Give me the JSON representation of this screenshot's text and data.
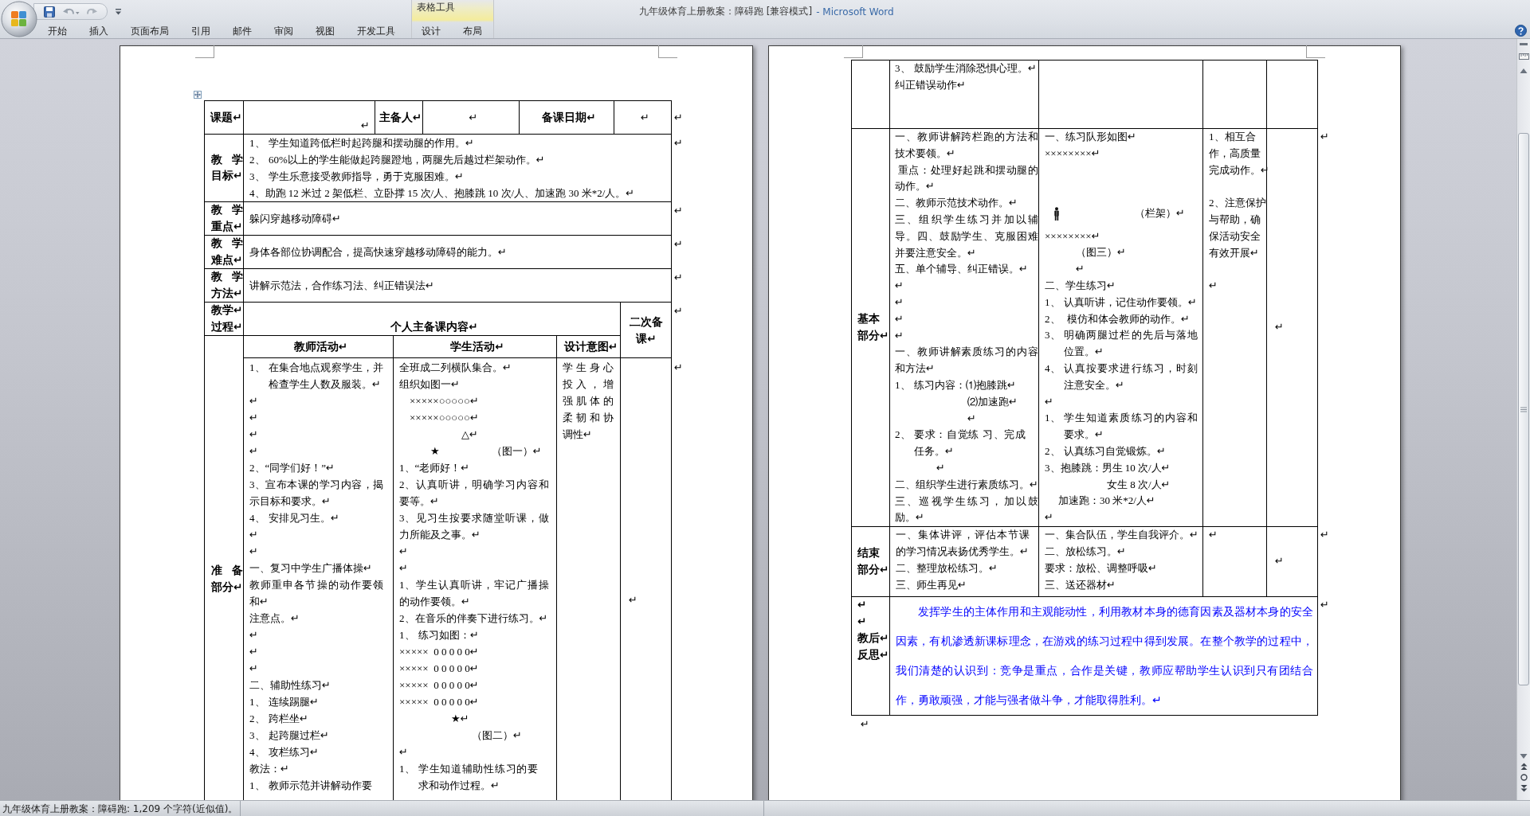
{
  "window": {
    "document_title": "九年级体育上册教案：障碍跑 [兼容模式]",
    "app_title": "- Microsoft Word"
  },
  "ribbon": {
    "tabs": [
      {
        "label": "开始",
        "selected": false
      },
      {
        "label": "插入",
        "selected": false
      },
      {
        "label": "页面布局",
        "selected": false
      },
      {
        "label": "引用",
        "selected": false
      },
      {
        "label": "邮件",
        "selected": false
      },
      {
        "label": "审阅",
        "selected": false
      },
      {
        "label": "视图",
        "selected": false
      },
      {
        "label": "开发工具",
        "selected": false
      }
    ],
    "contextual_group": {
      "title": "表格工具",
      "tabs": [
        {
          "label": "设计",
          "selected": false
        },
        {
          "label": "布局",
          "selected": false
        }
      ]
    }
  },
  "left_page": {
    "info_row": {
      "topic_label": "课题↵",
      "topic_value": "↵",
      "preparer_label": "主备人↵",
      "preparer_value": "↵",
      "date_label": "备课日期↵",
      "date_value": "↵",
      "end_mark": "↵"
    },
    "sections": [
      {
        "label": "教学目标↵",
        "paragraphs": [
          {
            "kind": "numbered",
            "number": "1、",
            "text": "学生知道跨低栏时起跨腿和摆动腿的作用。↵"
          },
          {
            "kind": "numbered",
            "number": "2、",
            "text": "60%以上的学生能做起跨腿蹬地，两腿先后越过栏架动作。↵"
          },
          {
            "kind": "numbered",
            "number": "3、",
            "text": "学生乐意接受教师指导，勇于克服困难。↵"
          },
          {
            "kind": "plain",
            "text": "4、助跑 12 米过 2 架低栏、立卧撑 15 次/人、抱膝跳 10 次/人、加速跑 30 米*2/人。↵"
          }
        ],
        "end_mark": "↵"
      },
      {
        "label": "教学重点↵",
        "paragraphs": [
          "躲闪穿越移动障碍↵"
        ],
        "end_mark": "↵"
      },
      {
        "label": "教学难点↵",
        "paragraphs": [
          "身体各部位协调配合，提高快速穿越移动障碍的能力。↵"
        ],
        "end_mark": "↵"
      },
      {
        "label": "教学方法↵",
        "paragraphs": [
          "讲解示范法，合作练习法、纠正错误法↵"
        ],
        "end_mark": "↵"
      }
    ],
    "process_row": {
      "label": [
        "教学↵",
        "过程↵"
      ],
      "title": "个人主备课内容↵",
      "second_title": "二次备课↵",
      "end_mark": "↵"
    },
    "column_headers": [
      "教师活动↵",
      "学生活动↵",
      "设计意图↵"
    ],
    "prep_row": {
      "label": "准备部分↵",
      "teacher": [
        {
          "kind": "numbered",
          "number": "1、",
          "text": "在集合地点观察学生，并检查学生人数及服装。↵"
        },
        {
          "kind": "plain",
          "text": "↵"
        },
        {
          "kind": "plain",
          "text": "↵"
        },
        {
          "kind": "plain",
          "text": "↵"
        },
        {
          "kind": "plain",
          "text": "↵"
        },
        {
          "kind": "plain",
          "text": "2、“同学们好！”↵"
        },
        {
          "kind": "plain",
          "text": "3、宣布本课的学习内容，揭示目标和要求。↵"
        },
        {
          "kind": "numbered",
          "number": "4、",
          "text": "安排见习生。↵"
        },
        {
          "kind": "plain",
          "text": "↵"
        },
        {
          "kind": "plain",
          "text": "↵"
        },
        {
          "kind": "plain",
          "text": "一、复习中学生广播体操↵"
        },
        {
          "kind": "plain",
          "text": "教师重申各节操的动作要领和↵"
        },
        {
          "kind": "plain",
          "text": "注意点。↵"
        },
        {
          "kind": "plain",
          "text": "↵"
        },
        {
          "kind": "plain",
          "text": "↵"
        },
        {
          "kind": "plain",
          "text": "↵"
        },
        {
          "kind": "plain",
          "text": "二、辅助性练习↵"
        },
        {
          "kind": "numbered",
          "number": "1、",
          "text": "连续踢腿↵"
        },
        {
          "kind": "numbered",
          "number": "2、",
          "text": "跨栏坐↵"
        },
        {
          "kind": "numbered",
          "number": "3、",
          "text": "起跨腿过栏↵"
        },
        {
          "kind": "numbered",
          "number": "4、",
          "text": "攻栏练习↵"
        },
        {
          "kind": "plain",
          "text": "教法：↵"
        },
        {
          "kind": "numbered",
          "number": "1、",
          "text": "教师示范并讲解动作要"
        }
      ],
      "student": [
        {
          "kind": "plain",
          "text": "全班成二列横队集合。↵"
        },
        {
          "kind": "plain",
          "text": "组织如图一↵"
        },
        {
          "kind": "plain",
          "text": "　×××××○○○○○↵"
        },
        {
          "kind": "plain",
          "text": "　×××××○○○○○↵"
        },
        {
          "kind": "plain",
          "text": "　　　　　　△↵"
        },
        {
          "kind": "plain",
          "text": "　　　★　　　　　（图一）↵"
        },
        {
          "kind": "plain",
          "text": "1、“老师好！↵"
        },
        {
          "kind": "plain",
          "text": "2、认真听讲，明确学习内容和要等。↵"
        },
        {
          "kind": "plain",
          "text": "3、见习生按要求随堂听课，做力所能及之事。↵"
        },
        {
          "kind": "plain",
          "text": "↵"
        },
        {
          "kind": "plain",
          "text": "↵"
        },
        {
          "kind": "plain",
          "text": "1、学生认真听讲，牢记广播操的动作要领。↵"
        },
        {
          "kind": "plain",
          "text": "2、在音乐的伴奏下进行练习。↵"
        },
        {
          "kind": "numbered",
          "number": "1、",
          "text": "练习如图：↵"
        },
        {
          "kind": "plain",
          "text": "×××××  0 0 0 0 0↵"
        },
        {
          "kind": "plain",
          "text": "×××××  0 0 0 0 0↵"
        },
        {
          "kind": "plain",
          "text": "×××××  0 0 0 0 0↵"
        },
        {
          "kind": "plain",
          "text": "×××××  0 0 0 0 0↵"
        },
        {
          "kind": "plain",
          "text": "　　　　　★↵"
        },
        {
          "kind": "plain",
          "text": "　　　　　　　（图二）↵"
        },
        {
          "kind": "plain",
          "text": "↵"
        },
        {
          "kind": "numbered",
          "number": "1、",
          "text": "学生知道辅助性练习的要求和动作过程。↵"
        }
      ],
      "design": "学生身心投入，增强肌体的柔韧和协调性↵",
      "second": "↵",
      "end_mark": "↵"
    }
  },
  "right_page": {
    "continued_row": {
      "teacher": [
        {
          "kind": "numbered",
          "number": "3、",
          "text": "鼓励学生消除恐惧心理。↵"
        },
        {
          "kind": "plain",
          "text": "纠正错误动作↵"
        }
      ]
    },
    "basic_row": {
      "label": "基本部分↵",
      "teacher": [
        {
          "kind": "plain",
          "text": "一、教师讲解跨栏跑的方法和技术要领。↵"
        },
        {
          "kind": "plain",
          "text": " 重点：处理好起跳和摆动腿的动作。↵"
        },
        {
          "kind": "plain",
          "text": "二、教师示范技术动作。↵"
        },
        {
          "kind": "plain",
          "text": "三、组织学生练习并加以辅导。四、鼓励学生、克服困难并要注意安全。↵"
        },
        {
          "kind": "plain",
          "text": "五、单个辅导、纠正错误。↵"
        },
        {
          "kind": "plain",
          "text": "↵"
        },
        {
          "kind": "plain",
          "text": "↵"
        },
        {
          "kind": "plain",
          "text": "↵"
        },
        {
          "kind": "plain",
          "text": "↵"
        },
        {
          "kind": "plain",
          "text": "一、教师讲解素质练习的内容和方法↵"
        },
        {
          "kind": "numbered",
          "number": "1、",
          "text": "练习内容：⑴抱膝跳↵"
        },
        {
          "kind": "plain",
          "text": "　　　　　　　⑵加速跑↵"
        },
        {
          "kind": "plain",
          "text": "　　　　　　　↵"
        },
        {
          "kind": "numbered",
          "number": "2、",
          "text": "要求：自觉练 习、完成任务。↵"
        },
        {
          "kind": "plain",
          "text": "　　　　↵"
        },
        {
          "kind": "plain",
          "text": "二、组织学生进行素质练习。↵"
        },
        {
          "kind": "plain",
          "text": "三、巡视学生练习，加以鼓励。↵"
        }
      ],
      "student_before": [
        "一、练习队形如图↵",
        "××××××××↵"
      ],
      "hurdle_caption": "（栏架）↵",
      "student_after": [
        {
          "kind": "plain",
          "text": "××××××××↵"
        },
        {
          "kind": "plain",
          "text": "　　　（图三）↵"
        },
        {
          "kind": "plain",
          "text": "　　　↵"
        },
        {
          "kind": "plain",
          "text": "二、学生练习↵"
        },
        {
          "kind": "numbered",
          "number": "1、",
          "text": "认真听讲，记住动作要领。↵"
        },
        {
          "kind": "numbered",
          "number": "2、",
          "text": " 模仿和体会教师的动作。↵"
        },
        {
          "kind": "numbered",
          "number": "3、",
          "text": "明确两腿过栏的先后与落地位置。↵"
        },
        {
          "kind": "numbered",
          "number": "4、",
          "text": "认真按要求进行练习，时刻注意安全。↵"
        },
        {
          "kind": "plain",
          "text": "↵"
        },
        {
          "kind": "numbered",
          "number": "1、",
          "text": "学生知道素质练习的内容和要求。↵"
        },
        {
          "kind": "numbered",
          "number": "2、",
          "text": "认真练习自觉锻炼。↵"
        },
        {
          "kind": "plain",
          "text": "3、抱膝跳：男生 10 次/人↵"
        },
        {
          "kind": "plain",
          "text": "　　　　　　女生 8 次/人↵"
        },
        {
          "kind": "plain",
          "text": "　 加速跑：30 米*2/人↵"
        },
        {
          "kind": "plain",
          "text": "↵"
        }
      ],
      "design": [
        "1、相互合作，高质量完成动作。↵",
        "2、注意保护与帮助，确保活动安全有效开展↵",
        "↵"
      ],
      "second": "↵",
      "end_mark": "↵"
    },
    "closing_row": {
      "label": "结束部分↵",
      "teacher": [
        "一、集体讲评，评估本节课的学习情况表扬优秀学生。↵",
        "二、整理放松练习。↵",
        "三、师生再见↵"
      ],
      "student": [
        "一、集合队伍，学生自我评介。↵",
        "二、放松练习。↵",
        "要求：放松、调整呼吸↵",
        "三、送还器材↵"
      ],
      "design": "↵",
      "second": "↵",
      "end_mark": "↵"
    },
    "reflection_row": {
      "label": [
        "↵",
        "↵",
        "教后↵",
        "反思↵"
      ],
      "text": "　　发挥学生的主体作用和主观能动性，利用教材本身的德育因素及器材本身的安全因素，有机渗透新课标理念，在游戏的练习过程中得到发展。在整个教学的过程中，我们清楚的认识到：竞争是重点，合作是关键，教师应帮助学生认识到只有团结合作，勇敢顽强，才能与强者做斗争，才能取得胜利。↵",
      "end_mark": "↵"
    },
    "after_mark": "↵"
  },
  "status_bar": {
    "text": "九年级体育上册教案：障碍跑: 1,209 个字符(近似值)。"
  }
}
